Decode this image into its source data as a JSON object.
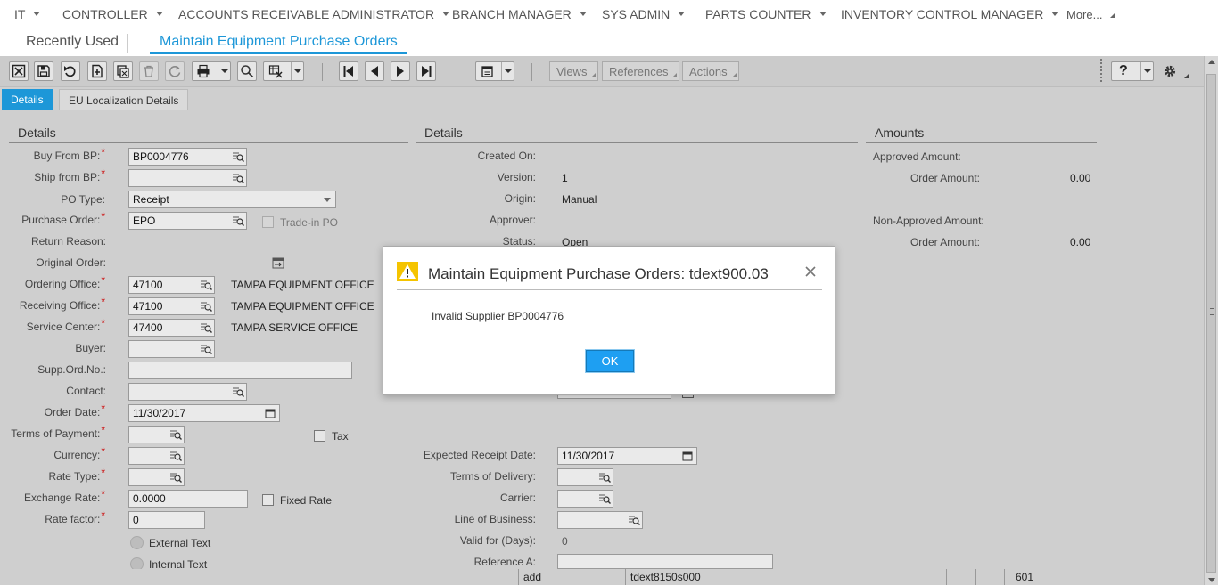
{
  "roles": [
    {
      "label": "IT"
    },
    {
      "label": "CONTROLLER"
    },
    {
      "label": "ACCOUNTS RECEIVABLE ADMINISTRATOR"
    },
    {
      "label": "BRANCH MANAGER"
    },
    {
      "label": "SYS ADMIN"
    },
    {
      "label": "PARTS COUNTER"
    },
    {
      "label": "INVENTORY CONTROL MANAGER"
    }
  ],
  "more_label": "More...",
  "session_tabs": {
    "recent": "Recently Used",
    "active": "Maintain Equipment Purchase Orders"
  },
  "toolbar": {
    "views": "Views",
    "references": "References",
    "actions": "Actions",
    "help": "?"
  },
  "tabs": {
    "details": "Details",
    "eu": "EU Localization Details"
  },
  "left": {
    "title": "Details",
    "buy_from_bp": {
      "label": "Buy From BP:",
      "value": "BP0004776"
    },
    "ship_from_bp": {
      "label": "Ship from BP:",
      "value": ""
    },
    "po_type": {
      "label": "PO Type:",
      "value": "Receipt"
    },
    "purchase_order": {
      "label": "Purchase Order:",
      "value": "EPO"
    },
    "trade_in": "Trade-in PO",
    "return_reason": "Return Reason:",
    "original_order": "Original Order:",
    "ordering_office": {
      "label": "Ordering Office:",
      "value": "47100",
      "desc": "TAMPA EQUIPMENT OFFICE"
    },
    "receiving_office": {
      "label": "Receiving Office:",
      "value": "47100",
      "desc": "TAMPA EQUIPMENT OFFICE"
    },
    "service_center": {
      "label": "Service Center:",
      "value": "47400",
      "desc": "TAMPA SERVICE OFFICE"
    },
    "buyer": "Buyer:",
    "supp_ord_no": "Supp.Ord.No.:",
    "contact": "Contact:",
    "order_date": {
      "label": "Order Date:",
      "value": "11/30/2017"
    },
    "terms_of_payment": "Terms of Payment:",
    "tax": "Tax",
    "currency": "Currency:",
    "rate_type": "Rate Type:",
    "exchange_rate": {
      "label": "Exchange Rate:",
      "value": "0.0000"
    },
    "fixed_rate": "Fixed Rate",
    "rate_factor": {
      "label": "Rate factor:",
      "value": "0"
    },
    "external_text": "External Text",
    "internal_text": "Internal Text"
  },
  "middle": {
    "title": "Details",
    "created_on": "Created On:",
    "version": {
      "label": "Version:",
      "value": "1"
    },
    "origin": {
      "label": "Origin:",
      "value": "Manual"
    },
    "approver": "Approver:",
    "status": {
      "label": "Status:",
      "value": "Open"
    },
    "expected_receipt_date": {
      "label": "Expected Receipt Date:",
      "value": "11/30/2017"
    },
    "terms_of_delivery": "Terms of Delivery:",
    "carrier": "Carrier:",
    "line_of_business": "Line of Business:",
    "valid_for_days": {
      "label": "Valid for (Days):",
      "value": "0"
    },
    "reference_a": "Reference A:"
  },
  "amounts": {
    "title": "Amounts",
    "approved_amount": "Approved Amount:",
    "order_amount_label": "Order Amount:",
    "approved_order_amount": "0.00",
    "non_approved_amount": "Non-Approved Amount:",
    "non_approved_order_amount": "0.00"
  },
  "status_bar": {
    "mode": "add",
    "session": "tdext8150s000",
    "company": "601"
  },
  "dialog": {
    "title": "Maintain Equipment Purchase Orders: tdext900.03",
    "message": "Invalid Supplier BP0004776",
    "ok_label": "OK"
  },
  "colors": {
    "accent": "#1d97d8",
    "required": "#cc0000",
    "warning": "#f5c400",
    "ok_button": "#1e9ff2"
  }
}
